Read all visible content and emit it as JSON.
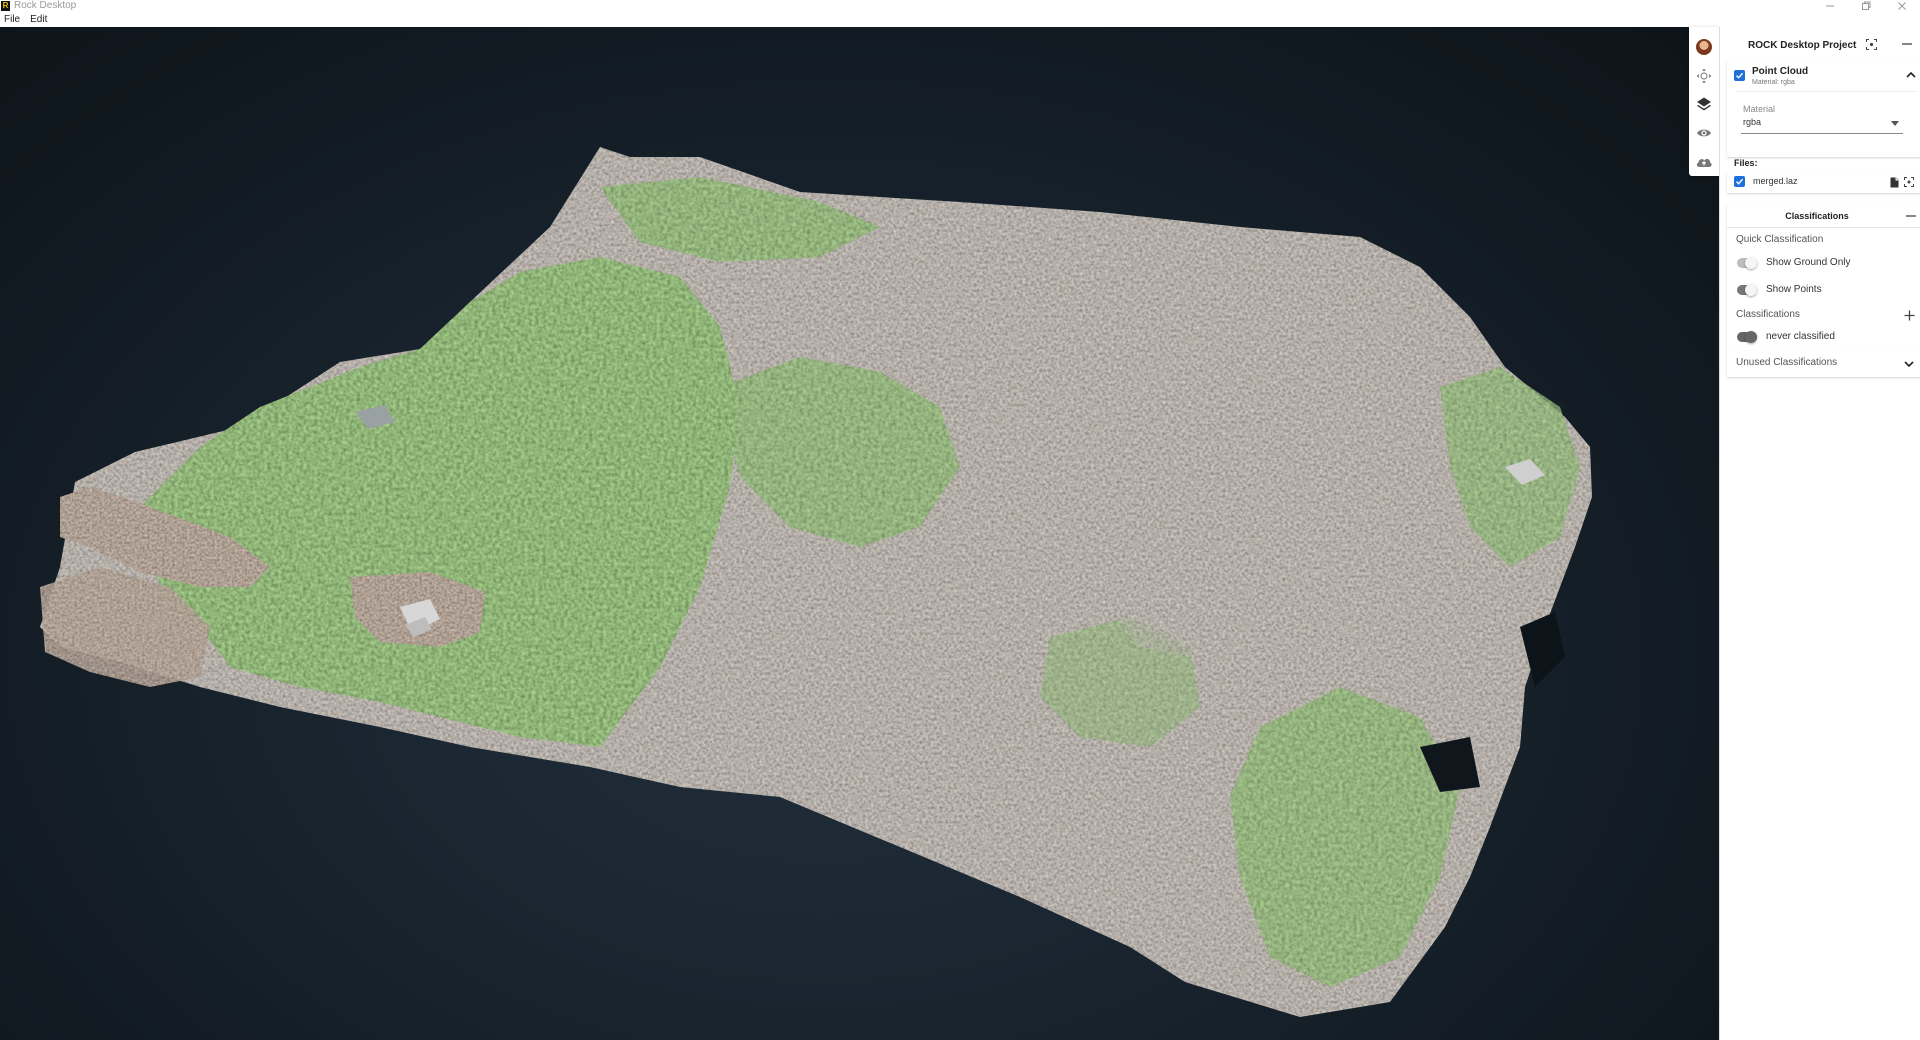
{
  "window": {
    "title": "Rock Desktop",
    "logo_letter": "R"
  },
  "menu": {
    "file": "File",
    "edit": "Edit"
  },
  "toolbar": {
    "items": [
      "avatar",
      "move-icon",
      "layers-icon",
      "eye-icon",
      "cloud-upload-icon"
    ]
  },
  "panel": {
    "project_title": "ROCK Desktop Project",
    "point_cloud": {
      "title": "Point Cloud",
      "subtitle": "Material: rgba",
      "checked": true,
      "material_label": "Material",
      "material_value": "rgba"
    },
    "files": {
      "label": "Files:",
      "items": [
        {
          "name": "merged.laz",
          "checked": true
        }
      ]
    },
    "classifications": {
      "header": "Classifications",
      "quick_label": "Quick Classification",
      "show_ground_only": {
        "label": "Show Ground Only",
        "on": false
      },
      "show_points": {
        "label": "Show Points",
        "on": true
      },
      "section_label": "Classifications",
      "items": [
        {
          "label": "never classified",
          "on": true
        }
      ],
      "unused_label": "Unused Classifications"
    }
  },
  "colors": {
    "accent": "#1e6fd9",
    "viewport_bg": "#162029",
    "toggle_on": "#666666",
    "toggle_off": "#bdbdbd"
  }
}
